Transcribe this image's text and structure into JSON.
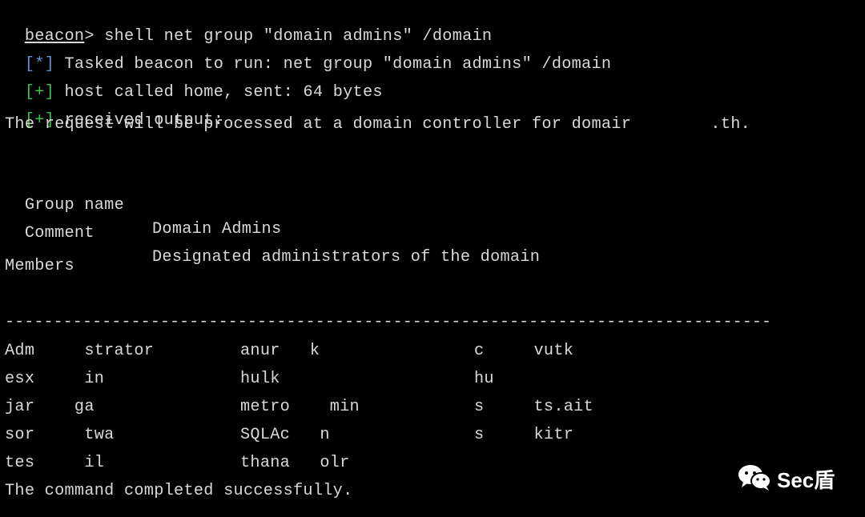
{
  "terminal": {
    "prompt": {
      "name": "beacon",
      "symbol": "> ",
      "command": "shell net group \"domain admins\" /domain"
    },
    "log": [
      {
        "tag": "[*]",
        "kind": "info",
        "text": " Tasked beacon to run: net group \"domain admins\" /domain"
      },
      {
        "tag": "[+]",
        "kind": "ok",
        "text": " host called home, sent: 64 bytes"
      },
      {
        "tag": "[+]",
        "kind": "ok",
        "text": " received output:"
      }
    ],
    "request_line": "The request will be processed at a domain controller for domair        .th.",
    "group_name": {
      "label": "Group name",
      "value": "Domain Admins"
    },
    "comment": {
      "label": "Comment",
      "value": "Designated administrators of the domain"
    },
    "members_label": "Members",
    "divider": "-------------------------------------------------------------------------------",
    "members": [
      [
        "Adm     strator",
        "anur   k",
        "c     vutk"
      ],
      [
        "esx     in",
        "hulk",
        "hu"
      ],
      [
        "jar    ga",
        "metro    min",
        "s     ts.ait"
      ],
      [
        "sor     twa",
        "SQLAc   n",
        "s     kitr"
      ],
      [
        "tes     il",
        "thana   olr",
        ""
      ]
    ],
    "footer": "The command completed successfully."
  },
  "watermark": {
    "icon": "wechat-icon",
    "text": "Sec盾"
  }
}
